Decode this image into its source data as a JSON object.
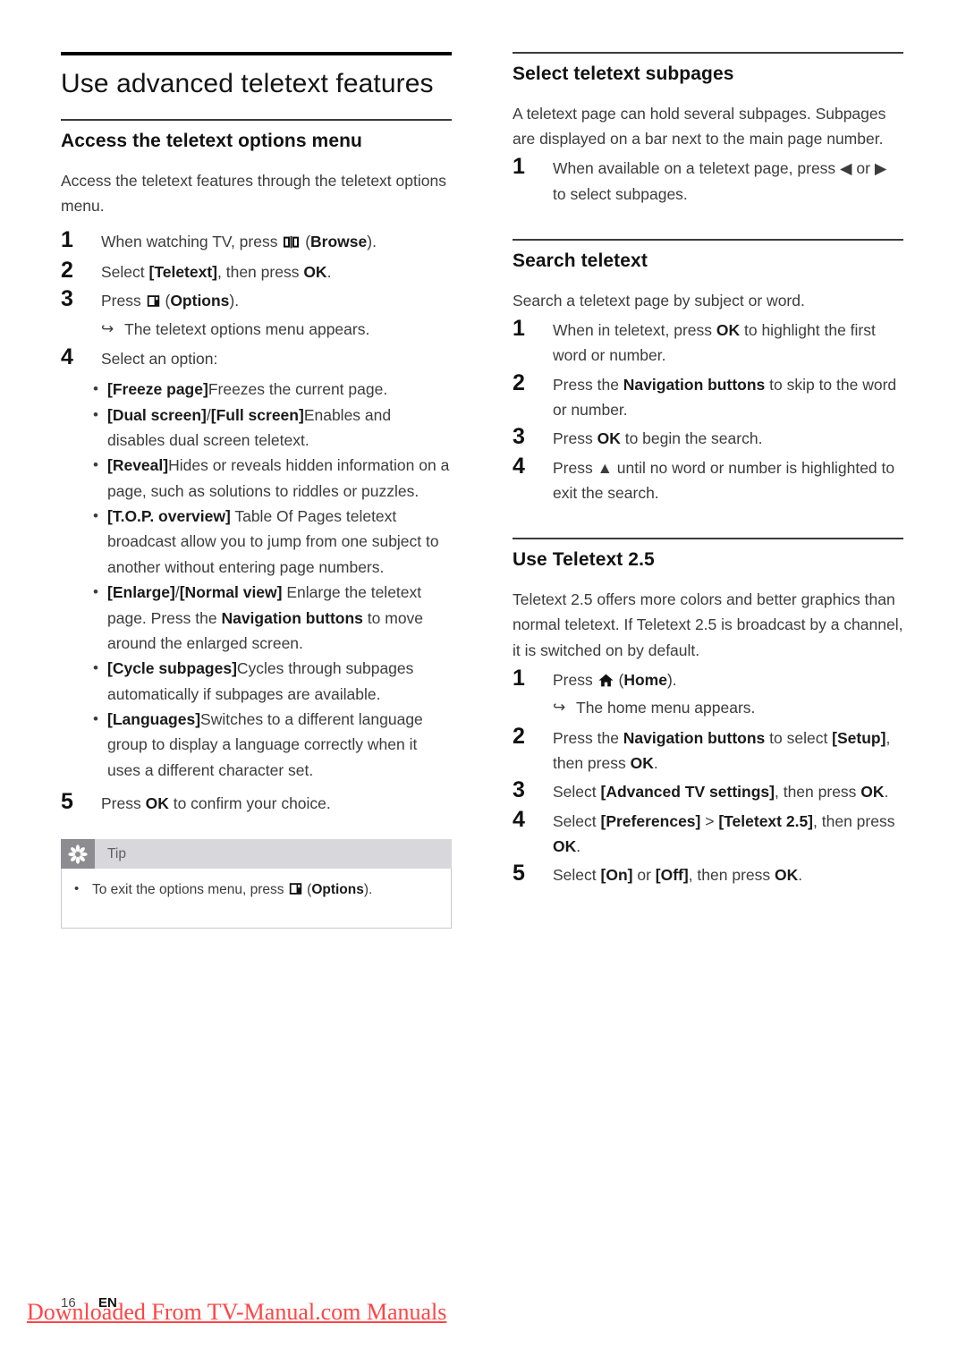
{
  "document": {
    "title": "Use advanced teletext features",
    "page_number": "16",
    "language_code": "EN",
    "watermark": "Downloaded From TV-Manual.com Manuals",
    "watermark_color": "#ff4444"
  },
  "icons": {
    "browse": "book-icon",
    "options": "options-icon",
    "home": "home-icon",
    "left": "◀",
    "right": "▶",
    "up": "▲",
    "arrow": "↪",
    "bullet": "•",
    "tip": "asterisk-icon"
  },
  "left_column": {
    "section1": {
      "heading": "Access the teletext options menu",
      "intro": "Access the teletext features through the teletext options menu.",
      "steps": [
        {
          "num": "1",
          "parts": [
            {
              "t": "When watching TV, press ",
              "b": false
            },
            {
              "t": "[ICON:browse]",
              "b": false
            },
            {
              "t": " (",
              "b": false
            },
            {
              "t": "Browse",
              "b": true
            },
            {
              "t": ").",
              "b": false
            }
          ]
        },
        {
          "num": "2",
          "parts": [
            {
              "t": "Select ",
              "b": false
            },
            {
              "t": "[Teletext]",
              "b": true
            },
            {
              "t": ", then press ",
              "b": false
            },
            {
              "t": "OK",
              "b": true
            },
            {
              "t": ".",
              "b": false
            }
          ]
        },
        {
          "num": "3",
          "parts": [
            {
              "t": "Press ",
              "b": false
            },
            {
              "t": "[ICON:options]",
              "b": false
            },
            {
              "t": " (",
              "b": false
            },
            {
              "t": "Options",
              "b": true
            },
            {
              "t": ").",
              "b": false
            }
          ],
          "substep": "The teletext options menu appears."
        },
        {
          "num": "4",
          "parts": [
            {
              "t": "Select an option:",
              "b": false
            }
          ]
        }
      ],
      "bullets": [
        [
          {
            "t": "[Freeze page]",
            "b": true
          },
          {
            "t": "Freezes the current page.",
            "b": false
          }
        ],
        [
          {
            "t": "[Dual screen]",
            "b": true
          },
          {
            "t": "/",
            "b": false
          },
          {
            "t": "[Full screen]",
            "b": true
          },
          {
            "t": "Enables and disables dual screen teletext.",
            "b": false
          }
        ],
        [
          {
            "t": "[Reveal]",
            "b": true
          },
          {
            "t": "Hides or reveals hidden information on a page, such as solutions to riddles or puzzles.",
            "b": false
          }
        ],
        [
          {
            "t": "[T.O.P. overview]",
            "b": true
          },
          {
            "t": " Table Of Pages teletext broadcast allow you to jump from one subject to another without entering page numbers.",
            "b": false
          }
        ],
        [
          {
            "t": "[Enlarge]",
            "b": true
          },
          {
            "t": "/",
            "b": false
          },
          {
            "t": "[Normal view]",
            "b": true
          },
          {
            "t": " Enlarge the teletext page. Press the ",
            "b": false
          },
          {
            "t": "Navigation buttons",
            "b": true
          },
          {
            "t": " to move around the enlarged screen.",
            "b": false
          }
        ],
        [
          {
            "t": "[Cycle subpages]",
            "b": true
          },
          {
            "t": "Cycles through subpages automatically if subpages are available.",
            "b": false
          }
        ],
        [
          {
            "t": "[Languages]",
            "b": true
          },
          {
            "t": "Switches to a different language group to display a language correctly when it uses a different character set.",
            "b": false
          }
        ]
      ],
      "final_step": {
        "num": "5",
        "parts": [
          {
            "t": "Press ",
            "b": false
          },
          {
            "t": "OK",
            "b": true
          },
          {
            "t": " to confirm your choice.",
            "b": false
          }
        ]
      }
    },
    "tip": {
      "label": "Tip",
      "items": [
        [
          {
            "t": "To exit the options menu, press ",
            "b": false
          },
          {
            "t": "[ICON:options]",
            "b": false
          },
          {
            "t": " (",
            "b": false
          },
          {
            "t": "Options",
            "b": true
          },
          {
            "t": ").",
            "b": false
          }
        ]
      ]
    }
  },
  "right_column": {
    "section2": {
      "heading": "Select teletext subpages",
      "intro": "A teletext page can hold several subpages. Subpages are displayed on a bar next to the main page number.",
      "steps": [
        {
          "num": "1",
          "parts": [
            {
              "t": "When available on a teletext page, press ",
              "b": false
            },
            {
              "t": "◀",
              "b": false
            },
            {
              "t": " or ",
              "b": false
            },
            {
              "t": "▶",
              "b": false
            },
            {
              "t": " to select subpages.",
              "b": false
            }
          ]
        }
      ]
    },
    "section3": {
      "heading": "Search teletext",
      "intro": "Search a teletext page by subject or word.",
      "steps": [
        {
          "num": "1",
          "parts": [
            {
              "t": "When in teletext, press ",
              "b": false
            },
            {
              "t": "OK",
              "b": true
            },
            {
              "t": " to highlight the first word or number.",
              "b": false
            }
          ]
        },
        {
          "num": "2",
          "parts": [
            {
              "t": "Press the ",
              "b": false
            },
            {
              "t": "Navigation buttons",
              "b": true
            },
            {
              "t": " to skip to the word or number.",
              "b": false
            }
          ]
        },
        {
          "num": "3",
          "parts": [
            {
              "t": "Press ",
              "b": false
            },
            {
              "t": "OK",
              "b": true
            },
            {
              "t": " to begin the search.",
              "b": false
            }
          ]
        },
        {
          "num": "4",
          "parts": [
            {
              "t": "Press ",
              "b": false
            },
            {
              "t": "▲",
              "b": false
            },
            {
              "t": " until no word or number is highlighted to exit the search.",
              "b": false
            }
          ]
        }
      ]
    },
    "section4": {
      "heading": "Use Teletext 2.5",
      "intro": "Teletext 2.5 offers more colors and better graphics than normal teletext. If Teletext 2.5 is broadcast by a channel, it is switched on by default.",
      "steps": [
        {
          "num": "1",
          "parts": [
            {
              "t": "Press ",
              "b": false
            },
            {
              "t": "[ICON:home]",
              "b": false
            },
            {
              "t": " (",
              "b": false
            },
            {
              "t": "Home",
              "b": true
            },
            {
              "t": ").",
              "b": false
            }
          ],
          "substep": "The home menu appears."
        },
        {
          "num": "2",
          "parts": [
            {
              "t": "Press the ",
              "b": false
            },
            {
              "t": "Navigation buttons",
              "b": true
            },
            {
              "t": " to select ",
              "b": false
            },
            {
              "t": "[Setup]",
              "b": true
            },
            {
              "t": ", then press ",
              "b": false
            },
            {
              "t": "OK",
              "b": true
            },
            {
              "t": ".",
              "b": false
            }
          ]
        },
        {
          "num": "3",
          "parts": [
            {
              "t": "Select ",
              "b": false
            },
            {
              "t": "[Advanced TV settings]",
              "b": true
            },
            {
              "t": ", then press ",
              "b": false
            },
            {
              "t": "OK",
              "b": true
            },
            {
              "t": ".",
              "b": false
            }
          ]
        },
        {
          "num": "4",
          "parts": [
            {
              "t": "Select ",
              "b": false
            },
            {
              "t": "[Preferences]",
              "b": true
            },
            {
              "t": " > ",
              "b": false
            },
            {
              "t": "[Teletext 2.5]",
              "b": true
            },
            {
              "t": ", then press ",
              "b": false
            },
            {
              "t": "OK",
              "b": true
            },
            {
              "t": ".",
              "b": false
            }
          ]
        },
        {
          "num": "5",
          "parts": [
            {
              "t": "Select ",
              "b": false
            },
            {
              "t": "[On]",
              "b": true
            },
            {
              "t": " or ",
              "b": false
            },
            {
              "t": "[Off]",
              "b": true
            },
            {
              "t": ", then press ",
              "b": false
            },
            {
              "t": "OK",
              "b": true
            },
            {
              "t": ".",
              "b": false
            }
          ]
        }
      ]
    }
  }
}
